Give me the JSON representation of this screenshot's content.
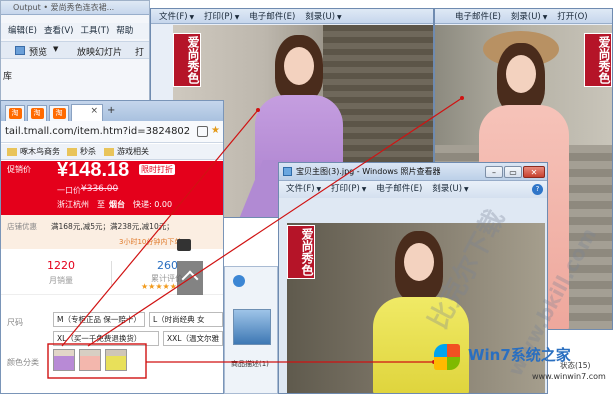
{
  "background_window": {
    "title": "Output • 爱尚秀色连衣裙...",
    "menu": [
      "编辑(E)",
      "查看(V)",
      "工具(T)",
      "帮助"
    ],
    "toolbar": [
      "预览",
      "放映幻灯片",
      "打"
    ],
    "side_text": "库"
  },
  "viewer_left": {
    "menu": [
      "文件(F)",
      "打印(P)",
      "电子邮件(E)",
      "刻录(U)"
    ],
    "caption": "爱尚秀色"
  },
  "viewer_right": {
    "menu": [
      "电子邮件(E)",
      "刻录(U)",
      "打开(O)"
    ],
    "caption": "爱尚秀色"
  },
  "viewer_front": {
    "title": "宝贝主图(3).jpg - Windows 照片查看器",
    "menu": [
      "文件(F)",
      "打印(P)",
      "电子邮件(E)",
      "刻录(U)"
    ],
    "caption": "爱尚秀色",
    "thumb_label": "商品描述(1)",
    "count_label": "状态(15)"
  },
  "browser": {
    "tabs": [
      "淘",
      "淘",
      "淘"
    ],
    "url": "tail.tmall.com/item.htm?id=3824802",
    "bookmarks": [
      "啄木鸟商务",
      "秒杀",
      "游戏相关"
    ],
    "price_label": "促销价",
    "price": "¥148.18",
    "promo_tag": "限时打折",
    "original_label": "一口价",
    "original_price": "¥336.00",
    "shipping_from": "浙江杭州",
    "shipping_to": "至",
    "shipping_city": "烟台",
    "shipping_express": "快递: 0.00",
    "coupon_label": "店铺优惠",
    "coupon_text": "满168元,减5元；满238元,减10元；",
    "coupon_note": "3小时10分钟内下单",
    "sales_value": "1220",
    "sales_label": "月销量",
    "reviews_value": "260",
    "reviews_label": "累计评价",
    "stars": "★★★★★",
    "size_label": "尺码",
    "sizes": [
      "M（专柜正品 保一赔十）",
      "L（时尚经典 女",
      "XL（买一千免费退换货）",
      "XXL（温文尔雅"
    ],
    "color_label": "颜色分类"
  },
  "watermarks": {
    "site": "www.bkill.com",
    "download": "比克尔下载",
    "win7_logo": "Win7系统之家",
    "win7_url": "www.winwin7.com"
  },
  "colors": {
    "price_red": "#e4001b",
    "tmall_red": "#b51428",
    "purple": "#b88ad6",
    "pink": "#f3b7ad",
    "yellow": "#e8e05a",
    "annotation": "#d01212"
  }
}
